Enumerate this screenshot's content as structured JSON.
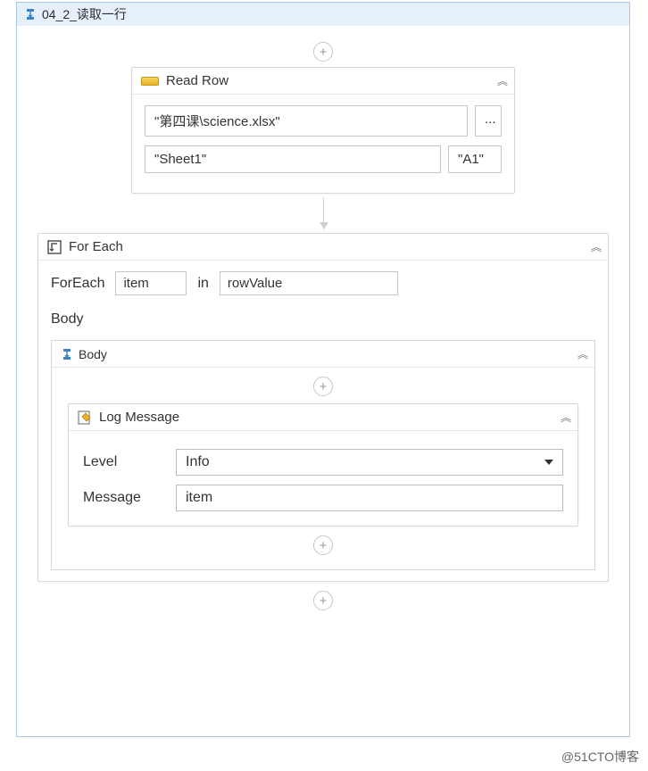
{
  "outer": {
    "title": "04_2_读取一行"
  },
  "readRow": {
    "title": "Read Row",
    "file": "\"第四课\\science.xlsx\"",
    "browse": "...",
    "sheet": "\"Sheet1\"",
    "cell": "\"A1\""
  },
  "forEach": {
    "title": "For Each",
    "label": "ForEach",
    "item": "item",
    "in": "in",
    "collection": "rowValue",
    "bodyLabel": "Body"
  },
  "bodySeq": {
    "title": "Body"
  },
  "logMessage": {
    "title": "Log Message",
    "levelLabel": "Level",
    "levelValue": "Info",
    "messageLabel": "Message",
    "messageValue": "item"
  },
  "watermark": "@51CTO博客"
}
